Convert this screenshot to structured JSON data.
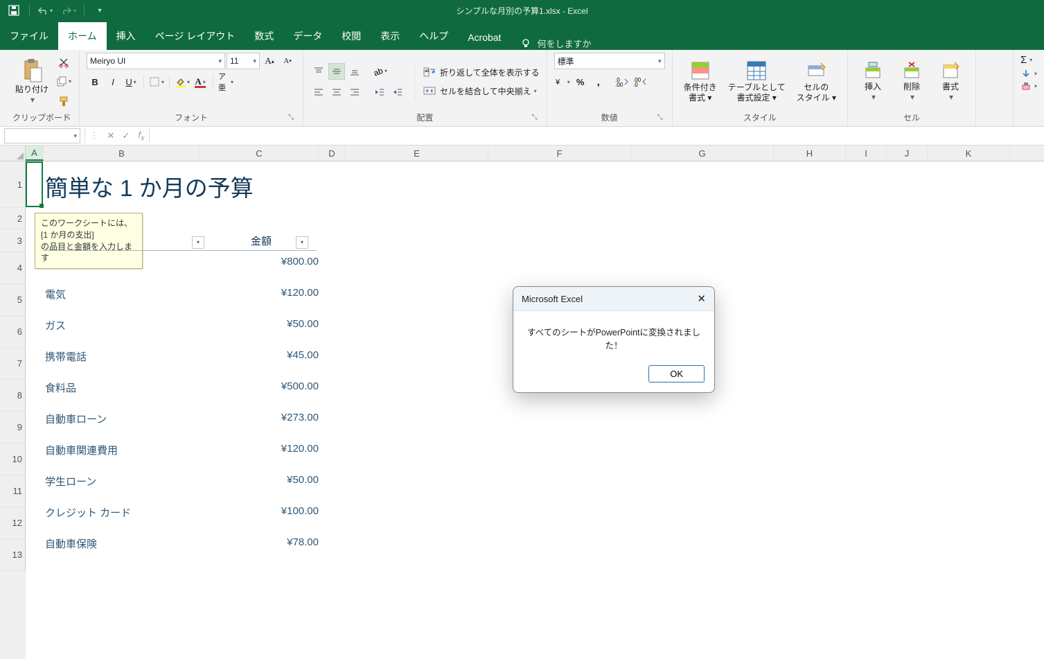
{
  "app": {
    "doc_title": "シンプルな月別の予算1.xlsx  -  Excel"
  },
  "tabs": {
    "file": "ファイル",
    "home": "ホーム",
    "insert": "挿入",
    "layout": "ページ レイアウト",
    "formulas": "数式",
    "data": "データ",
    "review": "校閲",
    "view": "表示",
    "help": "ヘルプ",
    "acrobat": "Acrobat",
    "tellme": "何をしますか"
  },
  "ribbon": {
    "clipboard": {
      "paste": "貼り付け",
      "label": "クリップボード"
    },
    "font": {
      "name": "Meiryo UI",
      "size": "11",
      "label": "フォント"
    },
    "align": {
      "wrap": "折り返して全体を表示する",
      "merge": "セルを結合して中央揃え",
      "label": "配置"
    },
    "number": {
      "format": "標準",
      "label": "数値"
    },
    "styles": {
      "cond": "条件付き\n書式 ▾",
      "table": "テーブルとして\n書式設定 ▾",
      "cell": "セルの\nスタイル ▾",
      "label": "スタイル"
    },
    "cells": {
      "insert": "挿入",
      "delete": "削除",
      "format": "書式",
      "label": "セル"
    }
  },
  "namebox": "",
  "columns": [
    "A",
    "B",
    "C",
    "D",
    "E",
    "F",
    "G",
    "H",
    "I",
    "J",
    "K"
  ],
  "rows": [
    "1",
    "2",
    "3",
    "4",
    "5",
    "6",
    "7",
    "8",
    "9",
    "10",
    "11",
    "12",
    "13"
  ],
  "title_text": "簡単な 1 か月の予算",
  "tooltip": "このワークシートには、[1 か月の支出]\nの品目と金額を入力します",
  "header_amount": "金額",
  "items": [
    {
      "name": "電気",
      "amount": "¥120.00"
    },
    {
      "name": "ガス",
      "amount": "¥50.00"
    },
    {
      "name": "携帯電話",
      "amount": "¥45.00"
    },
    {
      "name": "食料品",
      "amount": "¥500.00"
    },
    {
      "name": "自動車ローン",
      "amount": "¥273.00"
    },
    {
      "name": "自動車関連費用",
      "amount": "¥120.00"
    },
    {
      "name": "学生ローン",
      "amount": "¥50.00"
    },
    {
      "name": "クレジット カード",
      "amount": "¥100.00"
    },
    {
      "name": "自動車保険",
      "amount": "¥78.00"
    }
  ],
  "row4_amount": "¥800.00",
  "dialog": {
    "title": "Microsoft Excel",
    "msg": "すべてのシートがPowerPointに変換されました！",
    "ok": "OK"
  }
}
